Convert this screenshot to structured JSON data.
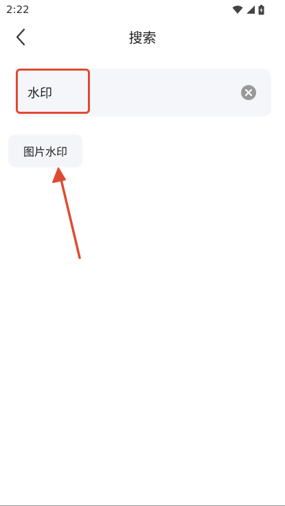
{
  "status_bar": {
    "time": "2:22",
    "icons": [
      "wifi-icon",
      "cellular-signal-icon",
      "battery-icon"
    ]
  },
  "header": {
    "title": "搜索",
    "back_icon": "chevron-left-icon"
  },
  "search": {
    "value": "水印",
    "clear_icon": "clear-circle-icon"
  },
  "suggestions": [
    {
      "label": "图片水印"
    }
  ],
  "colors": {
    "annotation": "#e04a32",
    "search_background": "#f5f6fa",
    "chip_background": "#f4f5f8",
    "clear_icon": "#999999"
  }
}
